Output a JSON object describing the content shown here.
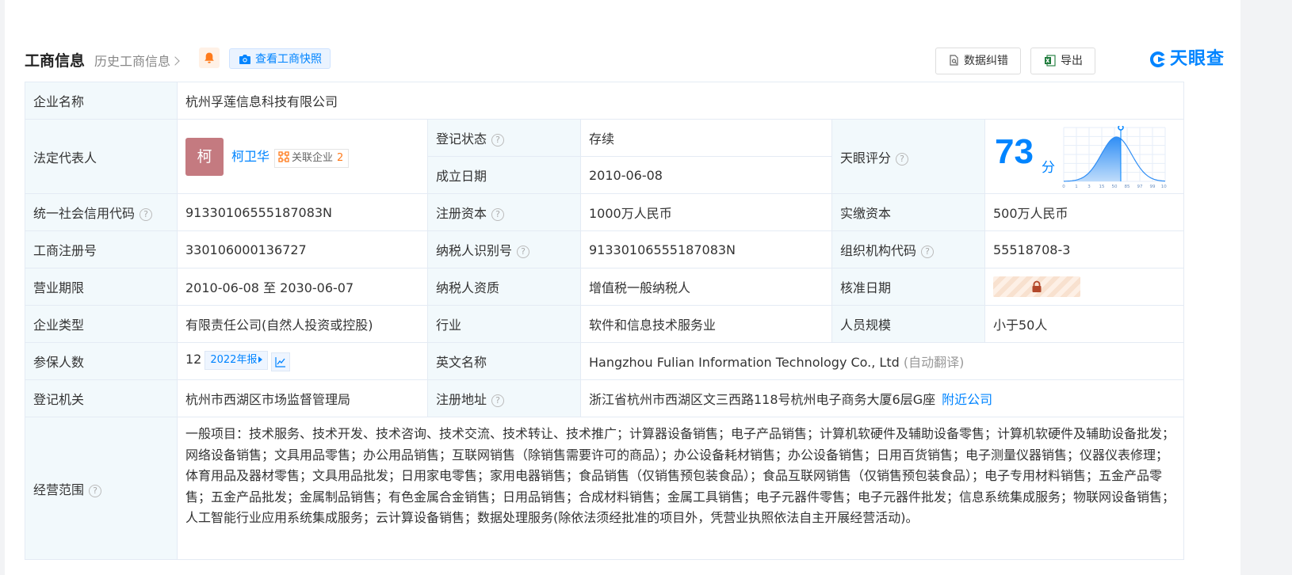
{
  "header": {
    "title": "工商信息",
    "history_link": "历史工商信息",
    "snapshot_button": "查看工商快照",
    "correction_button": "数据纠错",
    "export_button": "导出",
    "logo_text": "天眼查"
  },
  "colors": {
    "accent": "#0084ff",
    "label_bg": "#f2f9fc",
    "status_green": "#00b371",
    "bell": "#ff7a1a",
    "avatar": "#c47a80"
  },
  "icons": {
    "bell": "bell-icon",
    "camera": "camera-icon",
    "correction": "document-edit-icon",
    "export": "excel-icon",
    "help": "question-circle-icon",
    "related": "network-icon",
    "trend": "line-chart-icon",
    "lock": "lock-icon"
  },
  "labels": {
    "company_name": "企业名称",
    "legal_rep": "法定代表人",
    "reg_status": "登记状态",
    "found_date": "成立日期",
    "tianyan_score": "天眼评分",
    "credit_code": "统一社会信用代码",
    "reg_capital": "注册资本",
    "paid_capital": "实缴资本",
    "business_reg_no": "工商注册号",
    "taxpayer_id": "纳税人识别号",
    "org_code": "组织机构代码",
    "biz_term": "营业期限",
    "taxpayer_qual": "纳税人资质",
    "approval_date": "核准日期",
    "company_type": "企业类型",
    "industry": "行业",
    "staff_size": "人员规模",
    "insured_count": "参保人数",
    "english_name": "英文名称",
    "reg_authority": "登记机关",
    "reg_address": "注册地址",
    "biz_scope": "经营范围"
  },
  "values": {
    "company_name": "杭州孚莲信息科技有限公司",
    "avatar_char": "柯",
    "legal_rep_name": "柯卫华",
    "related_label": "关联企业",
    "related_count": "2",
    "reg_status": "存续",
    "found_date": "2010-06-08",
    "score": "73",
    "score_unit": "分",
    "credit_code": "91330106555187083N",
    "reg_capital": "1000万人民币",
    "paid_capital": "500万人民币",
    "business_reg_no": "330106000136727",
    "taxpayer_id": "91330106555187083N",
    "org_code": "55518708-3",
    "biz_term": "2010-06-08 至 2030-06-07",
    "taxpayer_qual": "增值税一般纳税人",
    "company_type": "有限责任公司(自然人投资或控股)",
    "industry": "软件和信息技术服务业",
    "staff_size": "小于50人",
    "insured_count": "12",
    "report_year": "2022年报",
    "english_name": "Hangzhou Fulian Information Technology Co., Ltd",
    "auto_translate": "(自动翻译)",
    "reg_authority": "杭州市西湖区市场监督管理局",
    "reg_address": "浙江省杭州市西湖区文三西路118号杭州电子商务大厦6层G座",
    "nearby_link": "附近公司",
    "biz_scope": "一般项目：技术服务、技术开发、技术咨询、技术交流、技术转让、技术推广；计算器设备销售；电子产品销售；计算机软硬件及辅助设备零售；计算机软硬件及辅助设备批发；网络设备销售；文具用品零售；办公用品销售；互联网销售（除销售需要许可的商品）；办公设备耗材销售；办公设备销售；日用百货销售；电子测量仪器销售；仪器仪表修理；体育用品及器材零售；文具用品批发；日用家电零售；家用电器销售；食品销售（仅销售预包装食品）；食品互联网销售（仅销售预包装食品）；电子专用材料销售；五金产品零售；五金产品批发；金属制品销售；有色金属合金销售；日用品销售；合成材料销售；金属工具销售；电子元器件零售；电子元器件批发；信息系统集成服务；物联网设备销售；人工智能行业应用系统集成服务；云计算设备销售；数据处理服务(除依法须经批准的项目外，凭营业执照依法自主开展经营活动)。"
  },
  "score_chart": {
    "ticks": [
      "0",
      "1",
      "3",
      "15",
      "50",
      "85",
      "97",
      "99",
      "100"
    ]
  }
}
